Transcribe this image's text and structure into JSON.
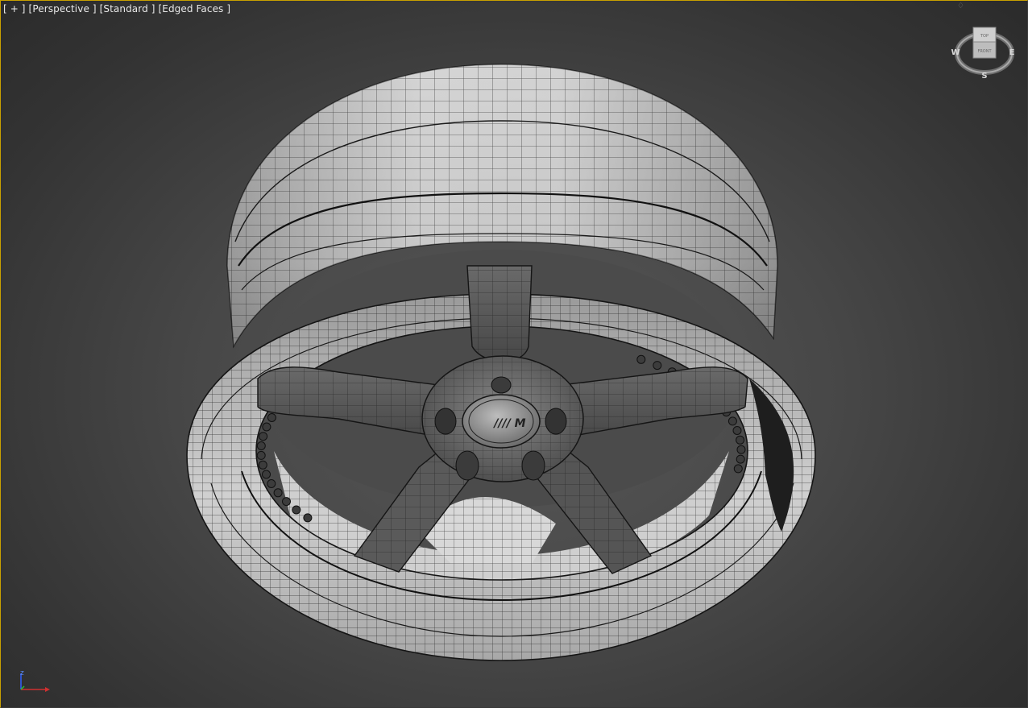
{
  "viewport": {
    "labels": [
      {
        "text": "[ + ]"
      },
      {
        "text": "[Perspective ]"
      },
      {
        "text": "[Standard ]"
      },
      {
        "text": "[Edged Faces ]"
      }
    ]
  },
  "viewcube": {
    "top_face": "TOP",
    "front_face": "FRONT",
    "compass": {
      "west": "W",
      "east": "E",
      "south": "S"
    }
  },
  "axis": {
    "z": "z"
  },
  "wheel": {
    "logo": "//// M"
  },
  "colors": {
    "viewport_bg": "#474747",
    "active_border": "#c8a000",
    "mesh_light": "#d9d9d9",
    "mesh_dark": "#4f4f4f",
    "wire": "#1a1a1a",
    "axis_x": "#d03030",
    "axis_y": "#2bbf2b",
    "axis_z": "#3060ff"
  }
}
